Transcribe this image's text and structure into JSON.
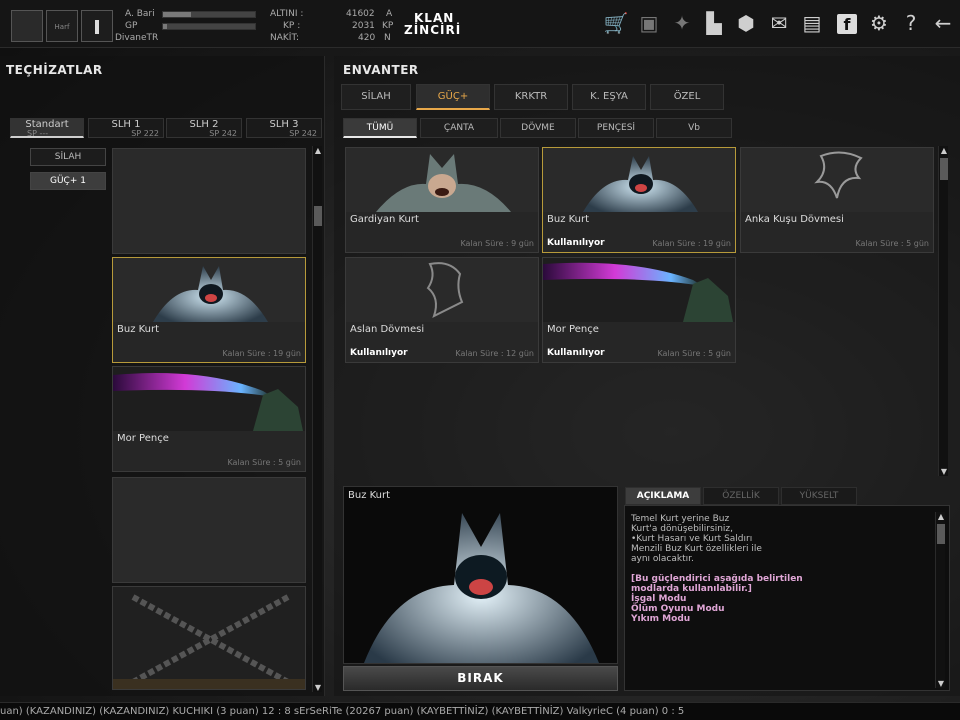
{
  "topbar": {
    "player": {
      "name": "A. Bari",
      "label_gp": "GP",
      "nickname": "DivaneTR"
    },
    "currency": {
      "altini_label": "ALTINI :",
      "kp_label": "KP :",
      "nakit_label": "NAKİT:"
    },
    "ranks": {
      "v1": "41602",
      "v2": "2031",
      "v3": "420",
      "k1": "A",
      "k2": "KP",
      "k3": "N"
    },
    "slot_label": "Harf",
    "klan_line1": "KLAN",
    "klan_line2": "ZİNCİRİ",
    "icons": [
      "shop-cart-icon",
      "bag-icon",
      "wolf-icon",
      "book-icon",
      "box-icon",
      "mail-icon",
      "folder-icon",
      "facebook-icon",
      "gear-icon",
      "help-icon",
      "back-arrow-icon"
    ]
  },
  "left": {
    "title": "TEÇHİZATLAR",
    "tabs": [
      {
        "label": "Standart",
        "sp": "SP ---"
      },
      {
        "label": "SLH 1",
        "sp": "SP 222"
      },
      {
        "label": "SLH 2",
        "sp": "SP 242"
      },
      {
        "label": "SLH 3",
        "sp": "SP 242"
      }
    ],
    "side_buttons": [
      "SİLAH",
      "GÜÇ+ 1"
    ],
    "cards": [
      {
        "name": "Buz Kurt",
        "time": "Kalan Süre : 19 gün"
      },
      {
        "name": "Mor Pençe",
        "time": "Kalan Süre : 5 gün"
      }
    ]
  },
  "right": {
    "title": "ENVANTER",
    "tabs": [
      "SİLAH",
      "GÜÇ+",
      "KRKTR",
      "K. EŞYA",
      "ÖZEL"
    ],
    "subtabs": [
      "TÜMÜ",
      "ÇANTA",
      "DÖVME",
      "PENÇESİ",
      "Vb"
    ],
    "items": [
      {
        "name": "Gardiyan Kurt",
        "time": "Kalan Süre : 9 gün",
        "using": ""
      },
      {
        "name": "Buz Kurt",
        "time": "Kalan Süre : 19 gün",
        "using": "Kullanılıyor"
      },
      {
        "name": "Anka Kuşu Dövmesi",
        "time": "Kalan Süre : 5 gün",
        "using": ""
      },
      {
        "name": "Aslan Dövmesi",
        "time": "Kalan Süre : 12 gün",
        "using": "Kullanılıyor"
      },
      {
        "name": "Mor Pençe",
        "time": "Kalan Süre : 5 gün",
        "using": "Kullanılıyor"
      }
    ],
    "preview_title": "Buz Kurt",
    "drop_button": "BIRAK",
    "info_tabs": [
      "AÇIKLAMA",
      "ÖZELLİK",
      "YÜKSELT"
    ],
    "desc_lines": [
      "Temel Kurt  yerine Buz",
      "Kurt'a dönüşebilirsiniz,",
      "•Kurt Hasarı ve Kurt Saldırı",
      "Menzili Buz Kurt özellikleri ile",
      "aynı olacaktır."
    ],
    "desc_modes": [
      "[Bu güçlendirici aşağıda belirtilen",
      "modlarda kullanılabilir.]",
      "İşgal Modu",
      "Ölüm Oyunu Modu",
      "Yıkım Modu"
    ]
  },
  "ticker": "uan) (KAZANDINIZ)        (KAZANDINIZ) KUCHIKI (3 puan) 12 : 8 sErSeRiTe (20267 puan) (KAYBETTİNİZ)                     (KAYBETTİNİZ) ValkyrieC (4 puan) 0 : 5",
  "colors": {
    "accent": "#e8a84a",
    "selected_border": "#b79a3a",
    "desc_pink": "#e0a6d6"
  }
}
